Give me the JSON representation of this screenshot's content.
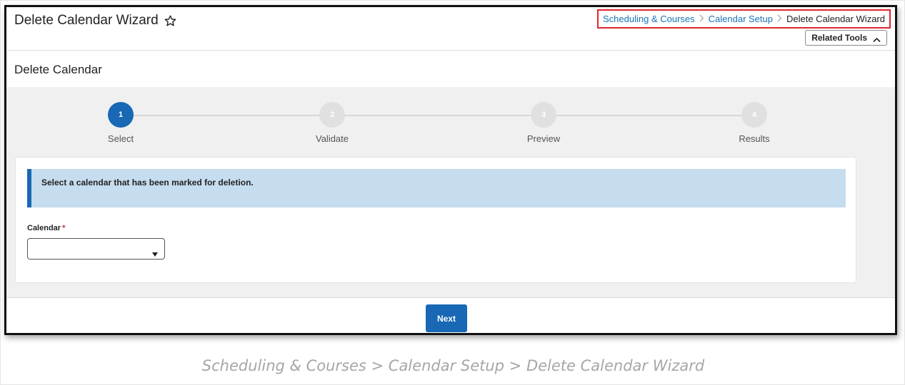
{
  "header": {
    "title": "Delete Calendar Wizard",
    "breadcrumb": {
      "link1": "Scheduling & Courses",
      "link2": "Calendar Setup",
      "current": "Delete Calendar Wizard"
    },
    "related_tools_label": "Related Tools"
  },
  "section": {
    "title": "Delete Calendar"
  },
  "stepper": {
    "steps": [
      {
        "number": "1",
        "label": "Select"
      },
      {
        "number": "2",
        "label": "Validate"
      },
      {
        "number": "3",
        "label": "Preview"
      },
      {
        "number": "4",
        "label": "Results"
      }
    ],
    "active_step": 1
  },
  "form": {
    "info_message": "Select a calendar that has been marked for deletion.",
    "calendar_label": "Calendar",
    "required_marker": "*",
    "calendar_value": ""
  },
  "footer": {
    "next_label": "Next"
  },
  "caption": "Scheduling & Courses > Calendar Setup > Delete Calendar Wizard",
  "colors": {
    "accent": "#1868b5",
    "info_bg": "#c6dcef",
    "highlight_border": "#e0262e"
  },
  "icons": {
    "favorite": "star-icon",
    "related_tools": "chevron-up-icon",
    "dropdown": "caret-icon"
  }
}
